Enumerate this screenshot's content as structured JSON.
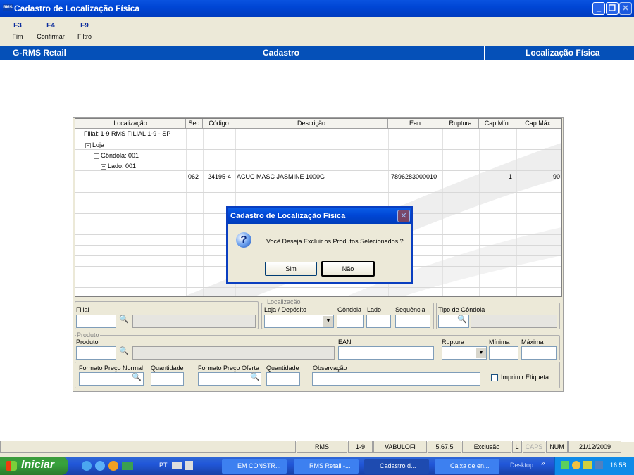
{
  "window": {
    "app_badge": "RMS",
    "title": "Cadastro de Localização Física",
    "min": "_",
    "max": "❐",
    "close": "✕"
  },
  "fkeys": [
    {
      "key": "F3",
      "label": "Fim"
    },
    {
      "key": "F4",
      "label": "Confirmar"
    },
    {
      "key": "F9",
      "label": "Filtro"
    }
  ],
  "header": {
    "left": "G-RMS Retail",
    "center": "Cadastro",
    "right": "Localização Física"
  },
  "grid": {
    "columns": [
      "Localização",
      "Seq",
      "Código",
      "Descrição",
      "Ean",
      "Ruptura",
      "Cap.Mín.",
      "Cap.Máx."
    ],
    "tree": [
      "Filial: 1-9  RMS FILIAL 1-9 - SP",
      "Loja",
      "Gôndola: 001",
      "Lado: 001"
    ],
    "row": {
      "seq": "062",
      "codigo": "24195-4",
      "descricao": "ACUC MASC JASMINE 1000G",
      "ean": "7896283000010",
      "ruptura": "",
      "capmin": "1",
      "capmax": "90"
    }
  },
  "form": {
    "filial": "Filial",
    "localizacao_group": "Localização",
    "loja_deposito": "Loja / Depósito",
    "gondola": "Gôndola",
    "lado": "Lado",
    "sequencia": "Sequência",
    "tipo_gondola": "Tipo de Gôndola",
    "produto_group": "Produto",
    "produto": "Produto",
    "ean": "EAN",
    "ruptura": "Ruptura",
    "minima": "Mínima",
    "maxima": "Máxima",
    "formato_normal": "Formato Preço Normal",
    "quantidade1": "Quantidade",
    "formato_oferta": "Formato Preço Oferta",
    "quantidade2": "Quantidade",
    "observacao": "Observação",
    "imprimir": "Imprimir Etiqueta"
  },
  "dialog": {
    "title": "Cadastro de Localização Física",
    "message": "Você Deseja Excluir os Produtos Selecionados ?",
    "yes": "Sim",
    "no": "Não",
    "icon": "question-icon"
  },
  "status": [
    "RMS",
    "1-9",
    "VABULOFI",
    "5.67.5",
    "Exclusão",
    "L",
    "CAPS",
    "NUM",
    "21/12/2009"
  ],
  "taskbar": {
    "start": "Iniciar",
    "lang": "PT",
    "tasks": [
      "EM CONSTR...",
      "RMS Retail -...",
      "Cadastro d...",
      "Caixa de en..."
    ],
    "desktop": "Desktop",
    "clock": "16:58"
  }
}
